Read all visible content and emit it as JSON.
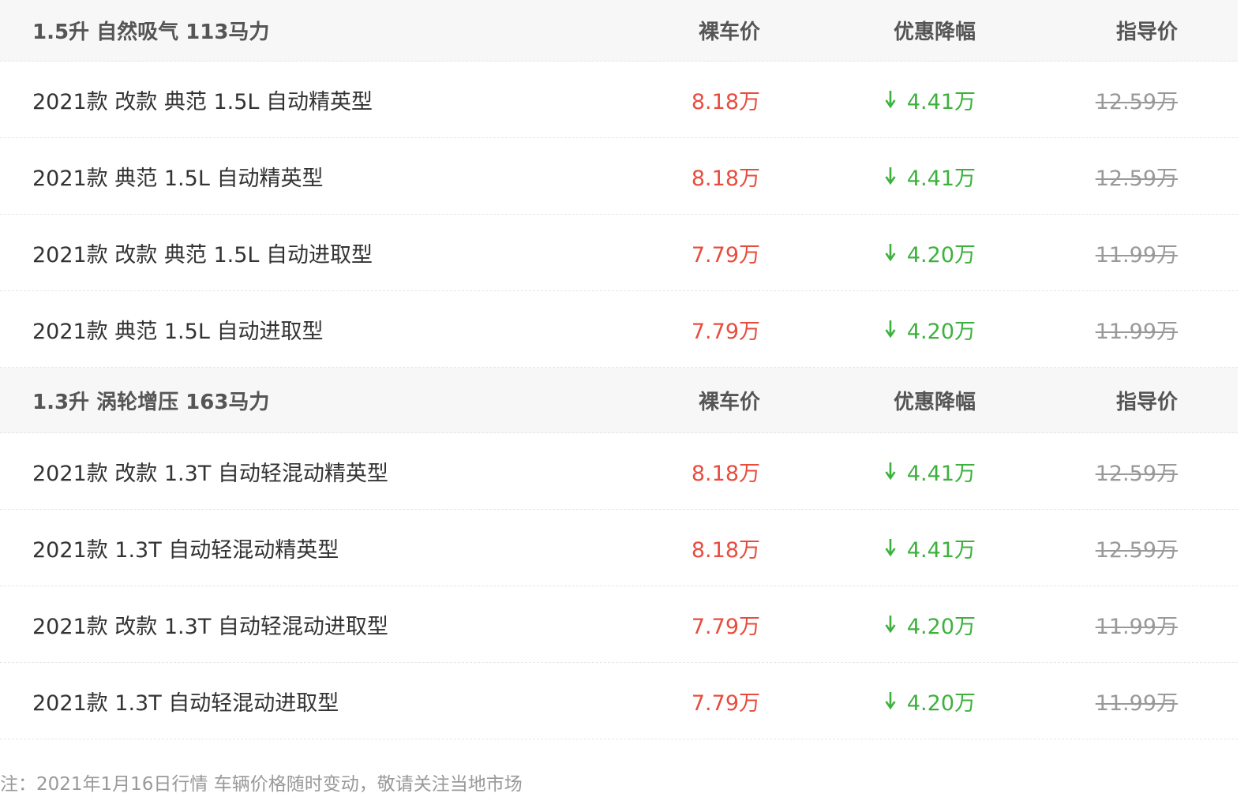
{
  "groups": [
    {
      "title": "1.5升 自然吸气 113马力",
      "col_price": "裸车价",
      "col_drop": "优惠降幅",
      "col_guide": "指导价",
      "rows": [
        {
          "name": "2021款 改款 典范 1.5L 自动精英型",
          "price": "8.18万",
          "drop": "4.41万",
          "guide": "12.59万"
        },
        {
          "name": "2021款 典范 1.5L 自动精英型",
          "price": "8.18万",
          "drop": "4.41万",
          "guide": "12.59万"
        },
        {
          "name": "2021款 改款 典范 1.5L 自动进取型",
          "price": "7.79万",
          "drop": "4.20万",
          "guide": "11.99万"
        },
        {
          "name": "2021款 典范 1.5L 自动进取型",
          "price": "7.79万",
          "drop": "4.20万",
          "guide": "11.99万"
        }
      ]
    },
    {
      "title": "1.3升 涡轮增压 163马力",
      "col_price": "裸车价",
      "col_drop": "优惠降幅",
      "col_guide": "指导价",
      "rows": [
        {
          "name": "2021款 改款 1.3T 自动轻混动精英型",
          "price": "8.18万",
          "drop": "4.41万",
          "guide": "12.59万"
        },
        {
          "name": "2021款 1.3T 自动轻混动精英型",
          "price": "8.18万",
          "drop": "4.41万",
          "guide": "12.59万"
        },
        {
          "name": "2021款 改款 1.3T 自动轻混动进取型",
          "price": "7.79万",
          "drop": "4.20万",
          "guide": "11.99万"
        },
        {
          "name": "2021款 1.3T 自动轻混动进取型",
          "price": "7.79万",
          "drop": "4.20万",
          "guide": "11.99万"
        }
      ]
    }
  ],
  "footnote": "注：2021年1月16日行情 车辆价格随时变动，敬请关注当地市场",
  "icons": {
    "drop": "arrow-down-icon"
  },
  "colors": {
    "price": "#e84c3d",
    "drop": "#3db13d",
    "guide": "#999999",
    "header_bg": "#f7f7f7"
  }
}
